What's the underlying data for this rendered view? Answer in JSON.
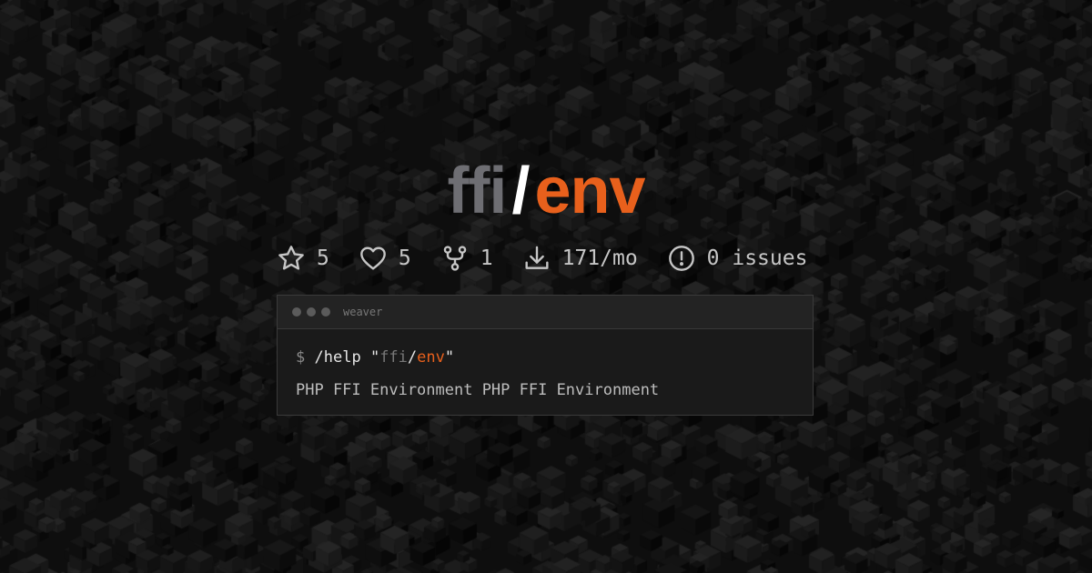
{
  "title": {
    "vendor": "ffi",
    "slash": "/",
    "package": "env"
  },
  "stats": [
    {
      "icon": "star-icon",
      "value": "5"
    },
    {
      "icon": "heart-icon",
      "value": "5"
    },
    {
      "icon": "fork-icon",
      "value": "1"
    },
    {
      "icon": "download-icon",
      "value": "171/mo"
    },
    {
      "icon": "issue-icon",
      "value": "0 issues"
    }
  ],
  "terminal": {
    "window_title": "weaver",
    "prompt": "$",
    "command": "/help",
    "quote_open": "\"",
    "arg_vendor": "ffi",
    "arg_slash": "/",
    "arg_package": "env",
    "quote_close": "\"",
    "output": "PHP FFI Environment PHP FFI Environment"
  },
  "colors": {
    "background": "#111111",
    "accent": "#e8601c",
    "vendor_gray": "#6e6e73",
    "slash_white": "#ffffff",
    "terminal_bg": "#1a1a1a",
    "terminal_bar": "#232323"
  }
}
